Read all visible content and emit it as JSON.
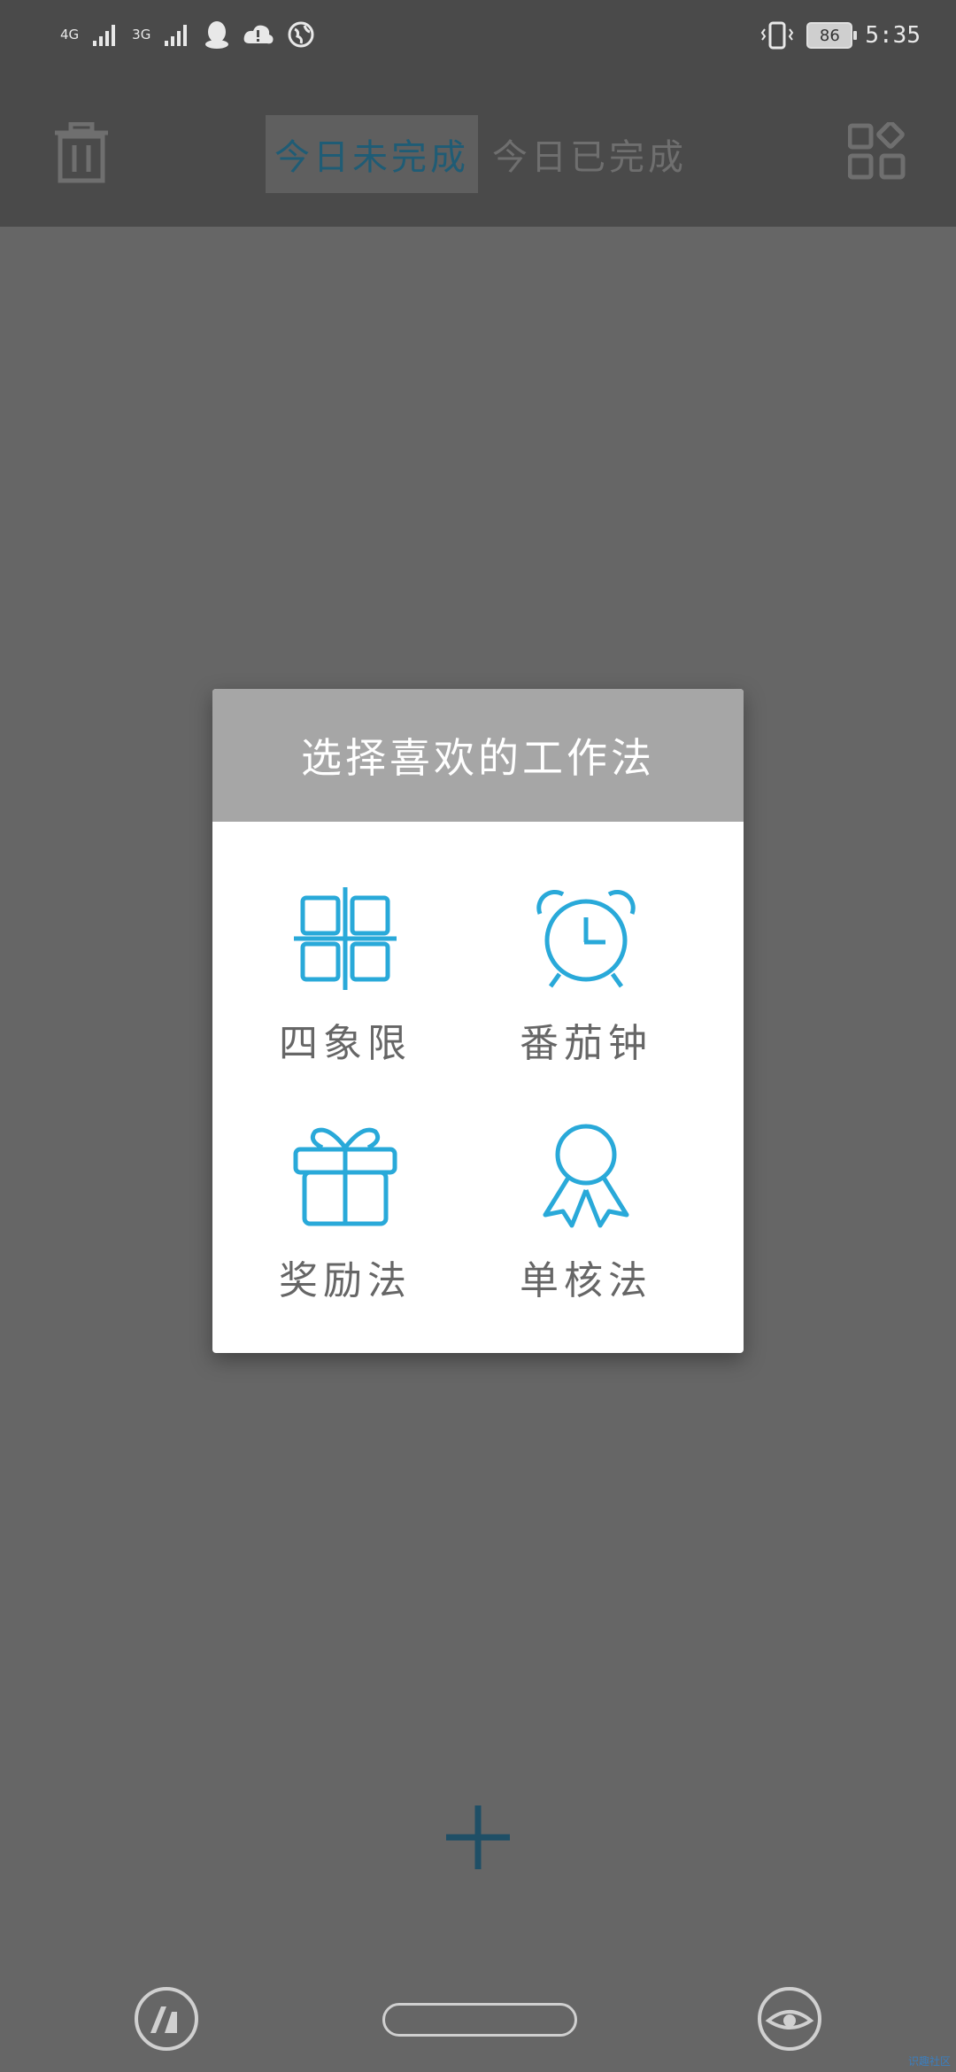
{
  "status_bar": {
    "network1": "4G",
    "network2": "3G",
    "battery": "86",
    "time": "5:35"
  },
  "header": {
    "tab_active": "今日未完成",
    "tab_inactive": "今日已完成"
  },
  "dialog": {
    "title": "选择喜欢的工作法",
    "options": [
      {
        "label": "四象限",
        "icon": "quadrant-icon"
      },
      {
        "label": "番茄钟",
        "icon": "alarm-clock-icon"
      },
      {
        "label": "奖励法",
        "icon": "gift-icon"
      },
      {
        "label": "单核法",
        "icon": "award-ribbon-icon"
      }
    ]
  },
  "colors": {
    "accent": "#29a9d9",
    "header_bg": "#4a4a4a",
    "overlay_bg": "#666666",
    "dialog_header_bg": "#a6a6a6"
  },
  "watermark": "识趣社区"
}
